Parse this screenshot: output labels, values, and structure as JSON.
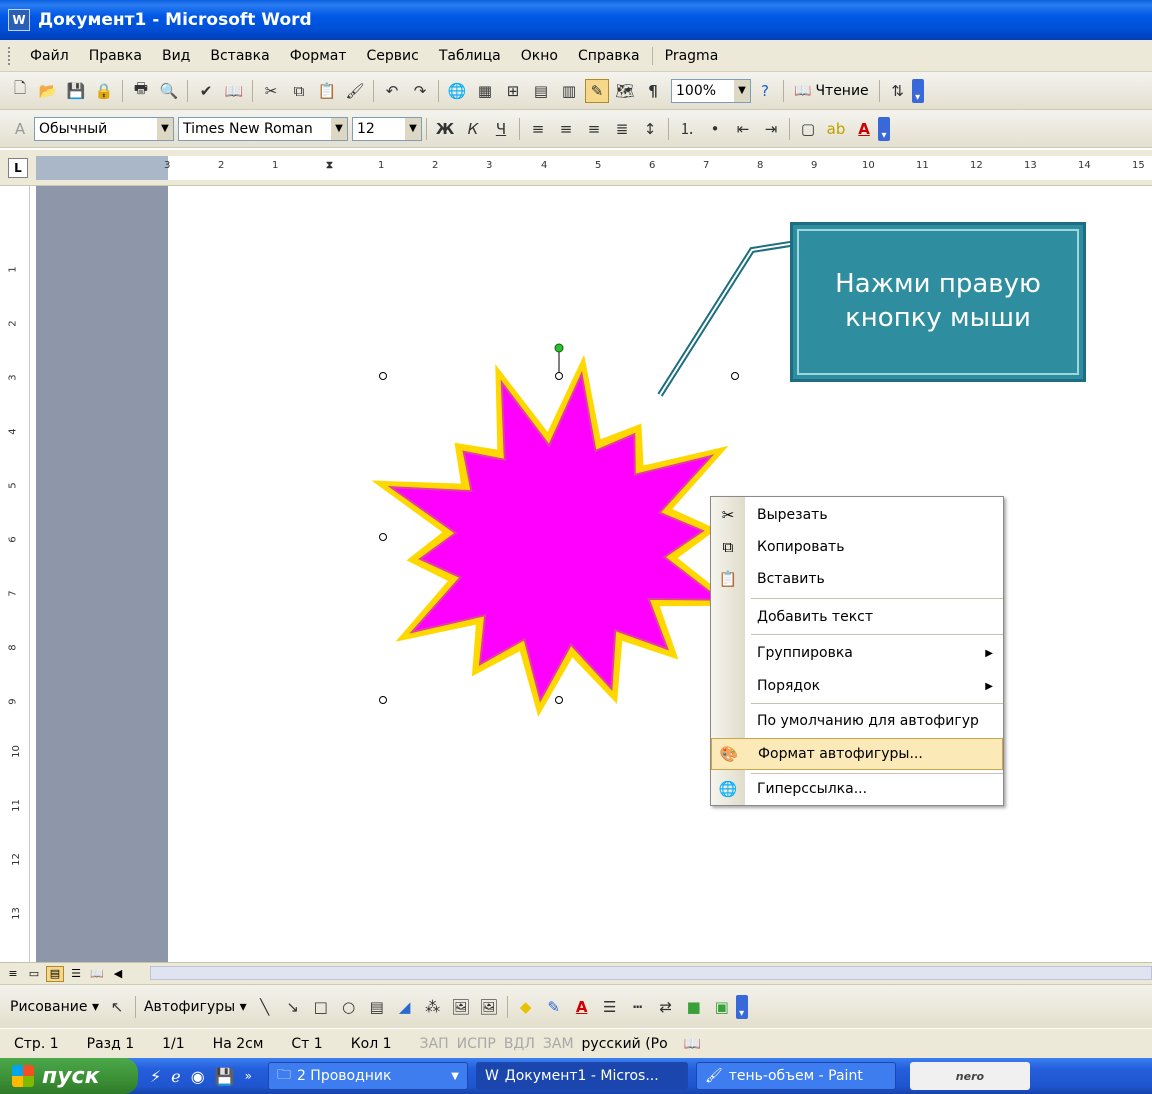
{
  "window": {
    "title": "Документ1 - Microsoft Word"
  },
  "menubar": {
    "items": [
      "Файл",
      "Правка",
      "Вид",
      "Вставка",
      "Формат",
      "Сервис",
      "Таблица",
      "Окно",
      "Справка",
      "Pragma"
    ]
  },
  "standard_toolbar": {
    "zoom": "100%",
    "reading_label": "Чтение"
  },
  "format_toolbar": {
    "style": "Обычный",
    "font": "Times New Roman",
    "size": "12"
  },
  "ruler": {
    "h_labels": [
      "3",
      "2",
      "1",
      "1",
      "2",
      "3",
      "4",
      "5",
      "6",
      "7",
      "8",
      "9",
      "10",
      "11",
      "12",
      "13",
      "14",
      "15"
    ],
    "v_labels": [
      "1",
      "2",
      "3",
      "4",
      "5",
      "6",
      "7",
      "8",
      "9",
      "10",
      "11",
      "12",
      "13"
    ]
  },
  "callout": {
    "line1": "Нажми правую",
    "line2": "кнопку мыши"
  },
  "shape": {
    "fill": "#ff00ff",
    "outline": "#ffd800"
  },
  "context_menu": {
    "items": [
      {
        "label": "Вырезать",
        "icon": "scissors-icon",
        "submenu": false
      },
      {
        "label": "Копировать",
        "icon": "copy-icon",
        "submenu": false
      },
      {
        "label": "Вставить",
        "icon": "paste-icon",
        "submenu": false
      },
      {
        "label": "Добавить текст",
        "icon": "",
        "submenu": false
      },
      {
        "label": "Группировка",
        "icon": "",
        "submenu": true
      },
      {
        "label": "Порядок",
        "icon": "",
        "submenu": true
      },
      {
        "label": "По умолчанию для автофигур",
        "icon": "",
        "submenu": false
      },
      {
        "label": "Формат автофигуры...",
        "icon": "format-autoshape-icon",
        "submenu": false,
        "highlighted": true
      },
      {
        "label": "Гиперссылка...",
        "icon": "hyperlink-icon",
        "submenu": false
      }
    ]
  },
  "drawing_toolbar": {
    "drawing_label": "Рисование",
    "autoshapes_label": "Автофигуры"
  },
  "status": {
    "page": "Стр. 1",
    "section": "Разд 1",
    "pages": "1/1",
    "at": "На 2см",
    "line": "Ст 1",
    "col": "Кол 1",
    "rec": "ЗАП",
    "trk": "ИСПР",
    "ext": "ВДЛ",
    "ovr": "ЗАМ",
    "lang": "русский (Ро"
  },
  "taskbar": {
    "start_label": "пуск",
    "tasks": [
      "2 Проводник",
      "Документ1 - Micros...",
      "тень-объем - Paint"
    ],
    "tray_label": "nero"
  }
}
